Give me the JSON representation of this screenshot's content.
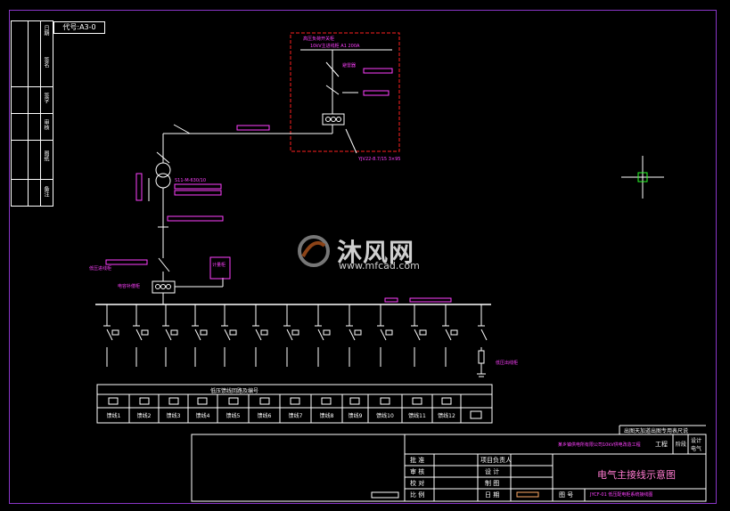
{
  "drawing_code": "代号:A3-0",
  "left_strip": [
    "日期",
    "签名",
    "签字",
    "审核",
    "图纸",
    "备注"
  ],
  "top_right_header": "出图天加道出图专用表尺说",
  "feeders": [
    "馈线1",
    "馈线2",
    "馈线3",
    "馈线4",
    "馈线5",
    "馈线6",
    "馈线7",
    "馈线8",
    "馈线9",
    "馈线10",
    "馈线11",
    "馈线12"
  ],
  "feeder_table_title": "低压馈线回路及编号",
  "title_block": {
    "project_name": "某乡镇供电所有限公司10kV供电改造工程",
    "project_suffix": "工程",
    "stage": "阶段",
    "stage_value": "设计",
    "discipline": "电气",
    "rows": [
      {
        "label": "批 准",
        "value": "项目负责人"
      },
      {
        "label": "审 核",
        "value": "设 计"
      },
      {
        "label": "校 对",
        "value": "制 图"
      },
      {
        "label": "比 例",
        "value": "日 期"
      }
    ],
    "drawing_title": "电气主接线示意图",
    "drawing_no_label": "图 号",
    "drawing_no": "JYCF-01 低压配电柜系统接线图"
  },
  "annotations": {
    "hv_box_title": "高压负荷开关柜",
    "hv_box_line": "10kV主进线柜 A1 200A",
    "transformer_label": "S11-M-630/10",
    "lightning_label": "避雷器",
    "cable_text": "YJV22-8.7/15 3×95",
    "lv_main": "低压进线柜",
    "meter_box": "计量柜",
    "capacitor": "电容补偿柜",
    "lv_cabinet": "低压出线柜"
  },
  "watermark": {
    "brand": "沐风网",
    "url": "www.mfcad.com"
  }
}
